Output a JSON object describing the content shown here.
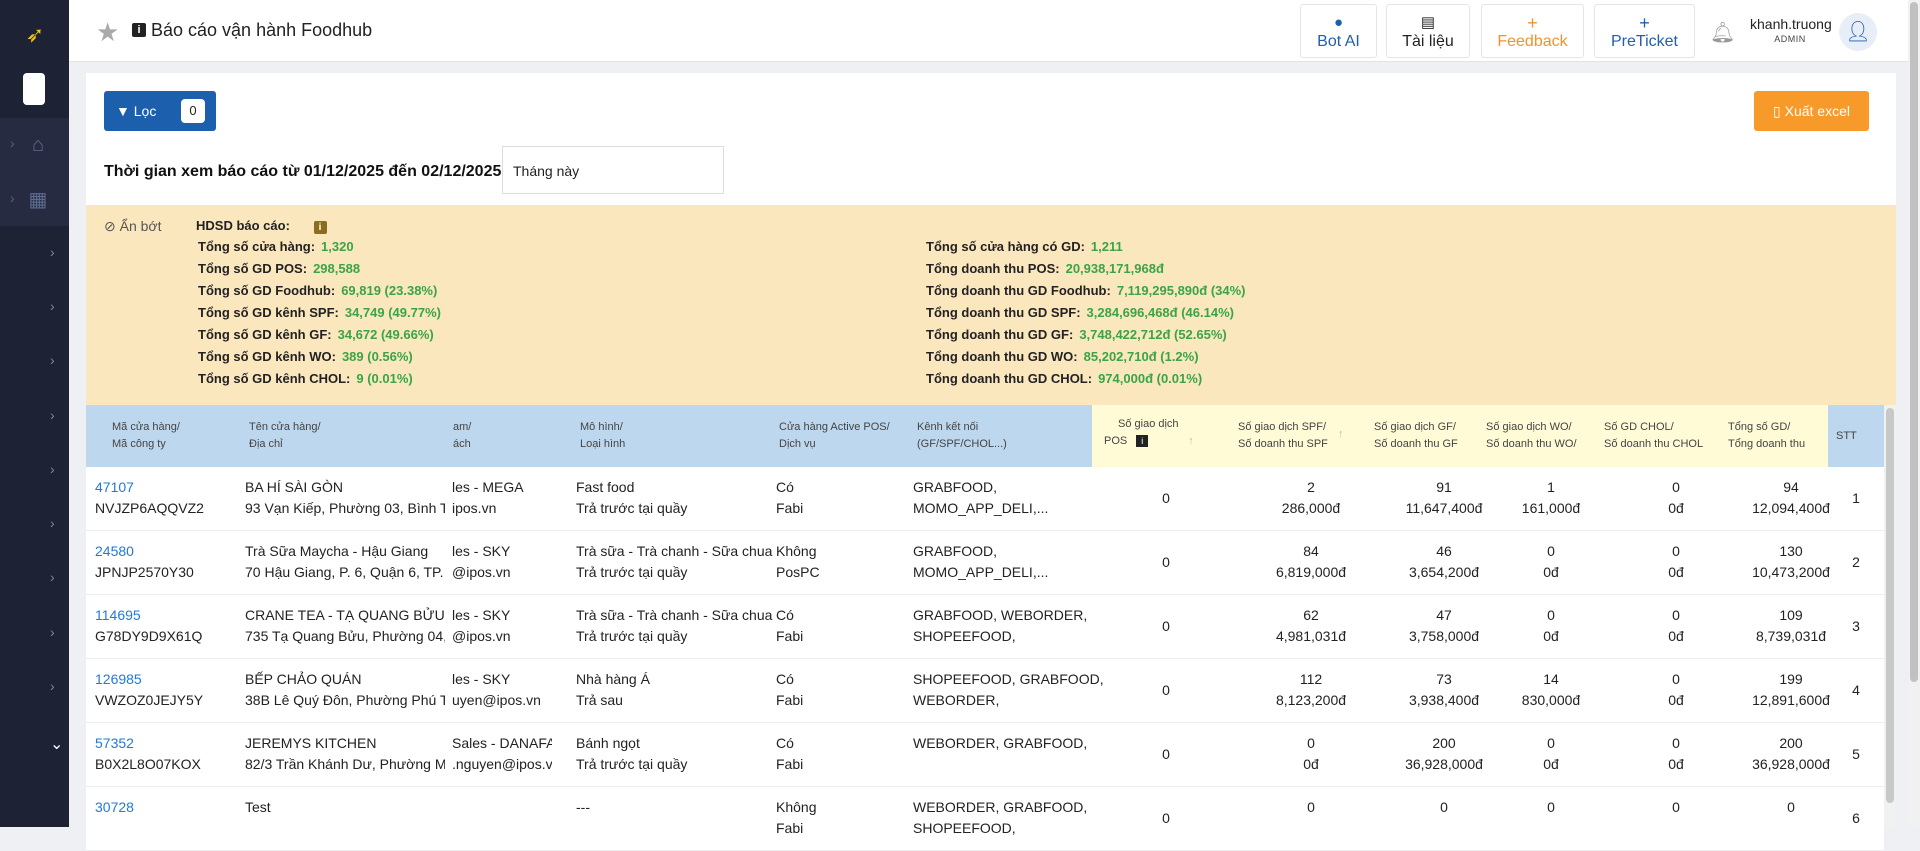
{
  "header": {
    "title": "Báo cáo vận hành Foodhub",
    "buttons": [
      {
        "label": "Bot AI",
        "color": "#1f5fad"
      },
      {
        "label": "Tài liệu",
        "color": "#222222"
      },
      {
        "label": "Feedback",
        "color": "#f0932b"
      },
      {
        "label": "PreTicket",
        "color": "#1f5fad"
      }
    ],
    "user": {
      "name": "khanh.truong",
      "role": "ADMIN"
    }
  },
  "toolbar": {
    "filter_label": "Lọc",
    "filter_count": "0",
    "export_label": "Xuất excel"
  },
  "time": {
    "label": "Thời gian xem báo cáo từ 01/12/2025 đến 02/12/2025:",
    "select_value": "Tháng này"
  },
  "summary": {
    "hide_label": "Ẩn bớt",
    "guide_label": "HDSD báo cáo:",
    "left": [
      {
        "label": "Tổng số cửa hàng:",
        "value": "1,320"
      },
      {
        "label": "Tổng số GD POS:",
        "value": "298,588"
      },
      {
        "label": "Tổng số GD Foodhub:",
        "value": "69,819 (23.38%)"
      },
      {
        "label": "Tổng số GD kênh SPF:",
        "value": "34,749 (49.77%)"
      },
      {
        "label": "Tổng số GD kênh GF:",
        "value": "34,672 (49.66%)"
      },
      {
        "label": "Tổng số GD kênh WO:",
        "value": "389 (0.56%)"
      },
      {
        "label": "Tổng số GD kênh CHOL:",
        "value": "9 (0.01%)"
      }
    ],
    "right": [
      {
        "label": "Tổng số cửa hàng có GD:",
        "value": "1,211"
      },
      {
        "label": "Tổng doanh thu POS:",
        "value": "20,938,171,968đ"
      },
      {
        "label": "Tổng doanh thu GD Foodhub:",
        "value": "7,119,295,890đ (34%)"
      },
      {
        "label": "Tổng doanh thu GD SPF:",
        "value": "3,284,696,468đ (46.14%)"
      },
      {
        "label": "Tổng doanh thu GD GF:",
        "value": "3,748,422,712đ (52.65%)"
      },
      {
        "label": "Tổng doanh thu GD WO:",
        "value": "85,202,710đ (1.2%)"
      },
      {
        "label": "Tổng doanh thu GD CHOL:",
        "value": "974,000đ (0.01%)"
      }
    ]
  },
  "table": {
    "headers": {
      "store": [
        "Mã cửa hàng/",
        "Mã công ty"
      ],
      "name": [
        "Tên cửa hàng/",
        "Địa chỉ"
      ],
      "team": [
        "am/",
        "ách"
      ],
      "model": [
        "Mô hình/",
        "Loại hình"
      ],
      "active": [
        "Cửa hàng Active POS/",
        "Dịch vụ"
      ],
      "channel": [
        "Kênh kết nối",
        "(GF/SPF/CHOL...)"
      ],
      "pos": [
        "Số giao dịch",
        "POS"
      ],
      "spf": [
        "Số giao dịch SPF/",
        "Số doanh thu SPF"
      ],
      "gf": [
        "Số giao dịch GF/",
        "Số doanh thu GF"
      ],
      "wo": [
        "Số giao dịch WO/",
        "Số doanh thu WO/"
      ],
      "chol": [
        "Số GD CHOL/",
        "Số doanh thu CHOL"
      ],
      "total": [
        "Tổng số GD/",
        "Tổng doanh thu"
      ],
      "stt": [
        "STT"
      ]
    },
    "rows": [
      {
        "code": "47107",
        "company": "NVJZP6AQQVZ2",
        "name": "BA HÍ SÀI GÒN",
        "address": "93 Vạn Kiếp, Phường 03, Bình T...",
        "team1": "les - MEGA",
        "team2": "ipos.vn",
        "model1": "Fast food",
        "model2": "Trả trước tại quầy",
        "active1": "Có",
        "active2": "Fabi",
        "channel1": "GRABFOOD,",
        "channel2": "MOMO_APP_DELI,...",
        "pos": "0",
        "spf1": "2",
        "spf2": "286,000đ",
        "gf1": "91",
        "gf2": "11,647,400đ",
        "wo1": "1",
        "wo2": "161,000đ",
        "chol1": "0",
        "chol2": "0đ",
        "total1": "94",
        "total2": "12,094,400đ",
        "stt": "1"
      },
      {
        "code": "24580",
        "company": "JPNJP2570Y30",
        "name": "Trà Sữa Maycha - Hậu Giang",
        "address": "70 Hậu Giang, P. 6, Quận 6, TP. H...",
        "team1": "les - SKY",
        "team2": "@ipos.vn",
        "model1": "Trà sữa - Trà chanh - Sữa chua",
        "model2": "Trả trước tại quầy",
        "active1": "Không",
        "active2": "PosPC",
        "channel1": "GRABFOOD,",
        "channel2": "MOMO_APP_DELI,...",
        "pos": "0",
        "spf1": "84",
        "spf2": "6,819,000đ",
        "gf1": "46",
        "gf2": "3,654,200đ",
        "wo1": "0",
        "wo2": "0đ",
        "chol1": "0",
        "chol2": "0đ",
        "total1": "130",
        "total2": "10,473,200đ",
        "stt": "2"
      },
      {
        "code": "114695",
        "company": "G78DY9D9X61Q",
        "name": "CRANE TEA - TẠ QUANG BỬU",
        "address": "735 Tạ Quang Bửu, Phường 04, ...",
        "team1": "les - SKY",
        "team2": "@ipos.vn",
        "model1": "Trà sữa - Trà chanh - Sữa chua",
        "model2": "Trả trước tại quầy",
        "active1": "Có",
        "active2": "Fabi",
        "channel1": "GRABFOOD, WEBORDER,",
        "channel2": "SHOPEEFOOD,",
        "pos": "0",
        "spf1": "62",
        "spf2": "4,981,031đ",
        "gf1": "47",
        "gf2": "3,758,000đ",
        "wo1": "0",
        "wo2": "0đ",
        "chol1": "0",
        "chol2": "0đ",
        "total1": "109",
        "total2": "8,739,031đ",
        "stt": "3"
      },
      {
        "code": "126985",
        "company": "VWZOZ0JEJY5Y",
        "name": "BẾP CHẢO QUÁN",
        "address": "38B Lê Quý Đôn, Phường Phú T...",
        "team1": "les - SKY",
        "team2": "uyen@ipos.vn",
        "model1": "Nhà hàng Á",
        "model2": "Trả sau",
        "active1": "Có",
        "active2": "Fabi",
        "channel1": "SHOPEEFOOD, GRABFOOD,",
        "channel2": "WEBORDER,",
        "pos": "0",
        "spf1": "112",
        "spf2": "8,123,200đ",
        "gf1": "73",
        "gf2": "3,938,400đ",
        "wo1": "14",
        "wo2": "830,000đ",
        "chol1": "0",
        "chol2": "0đ",
        "total1": "199",
        "total2": "12,891,600đ",
        "stt": "4"
      },
      {
        "code": "57352",
        "company": "B0X2L8O07KOX",
        "name": "JEREMYS KITCHEN",
        "address": "82/3 Trần Khánh Dư, Phường M...",
        "team1": "Sales - DANAFA",
        "team2": ".nguyen@ipos.vn",
        "model1": "Bánh ngọt",
        "model2": "Trả trước tại quầy",
        "active1": "Có",
        "active2": "Fabi",
        "channel1": "WEBORDER, GRABFOOD,",
        "channel2": "",
        "pos": "0",
        "spf1": "0",
        "spf2": "0đ",
        "gf1": "200",
        "gf2": "36,928,000đ",
        "wo1": "0",
        "wo2": "0đ",
        "chol1": "0",
        "chol2": "0đ",
        "total1": "200",
        "total2": "36,928,000đ",
        "stt": "5"
      },
      {
        "code": "30728",
        "company": "",
        "name": "Test",
        "address": "",
        "team1": "",
        "team2": "",
        "model1": "---",
        "model2": "",
        "active1": "Không",
        "active2": "Fabi",
        "channel1": "WEBORDER, GRABFOOD,",
        "channel2": "SHOPEEFOOD,",
        "pos": "0",
        "spf1": "0",
        "spf2": "",
        "gf1": "0",
        "gf2": "",
        "wo1": "0",
        "wo2": "",
        "chol1": "0",
        "chol2": "",
        "total1": "0",
        "total2": "",
        "stt": "6"
      }
    ]
  },
  "colors": {
    "primary": "#1c5fad",
    "accent": "#f79a29",
    "summary_bg": "#fbe7bd",
    "value_green": "#3aa447",
    "header_blue": "#bdd7ee",
    "header_yellow": "#fffbd6"
  }
}
